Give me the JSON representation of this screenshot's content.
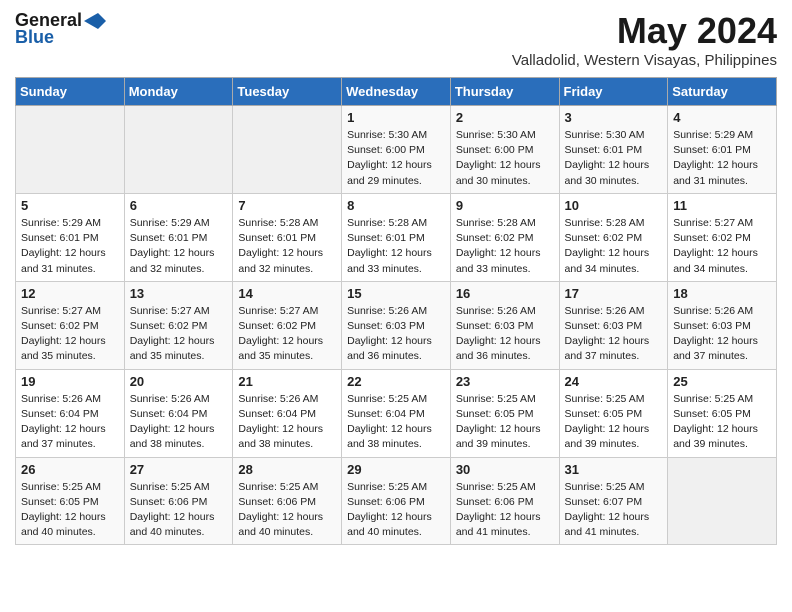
{
  "header": {
    "logo_general": "General",
    "logo_blue": "Blue",
    "title": "May 2024",
    "location": "Valladolid, Western Visayas, Philippines"
  },
  "weekdays": [
    "Sunday",
    "Monday",
    "Tuesday",
    "Wednesday",
    "Thursday",
    "Friday",
    "Saturday"
  ],
  "weeks": [
    [
      {
        "day": "",
        "info": ""
      },
      {
        "day": "",
        "info": ""
      },
      {
        "day": "",
        "info": ""
      },
      {
        "day": "1",
        "info": "Sunrise: 5:30 AM\nSunset: 6:00 PM\nDaylight: 12 hours\nand 29 minutes."
      },
      {
        "day": "2",
        "info": "Sunrise: 5:30 AM\nSunset: 6:00 PM\nDaylight: 12 hours\nand 30 minutes."
      },
      {
        "day": "3",
        "info": "Sunrise: 5:30 AM\nSunset: 6:01 PM\nDaylight: 12 hours\nand 30 minutes."
      },
      {
        "day": "4",
        "info": "Sunrise: 5:29 AM\nSunset: 6:01 PM\nDaylight: 12 hours\nand 31 minutes."
      }
    ],
    [
      {
        "day": "5",
        "info": "Sunrise: 5:29 AM\nSunset: 6:01 PM\nDaylight: 12 hours\nand 31 minutes."
      },
      {
        "day": "6",
        "info": "Sunrise: 5:29 AM\nSunset: 6:01 PM\nDaylight: 12 hours\nand 32 minutes."
      },
      {
        "day": "7",
        "info": "Sunrise: 5:28 AM\nSunset: 6:01 PM\nDaylight: 12 hours\nand 32 minutes."
      },
      {
        "day": "8",
        "info": "Sunrise: 5:28 AM\nSunset: 6:01 PM\nDaylight: 12 hours\nand 33 minutes."
      },
      {
        "day": "9",
        "info": "Sunrise: 5:28 AM\nSunset: 6:02 PM\nDaylight: 12 hours\nand 33 minutes."
      },
      {
        "day": "10",
        "info": "Sunrise: 5:28 AM\nSunset: 6:02 PM\nDaylight: 12 hours\nand 34 minutes."
      },
      {
        "day": "11",
        "info": "Sunrise: 5:27 AM\nSunset: 6:02 PM\nDaylight: 12 hours\nand 34 minutes."
      }
    ],
    [
      {
        "day": "12",
        "info": "Sunrise: 5:27 AM\nSunset: 6:02 PM\nDaylight: 12 hours\nand 35 minutes."
      },
      {
        "day": "13",
        "info": "Sunrise: 5:27 AM\nSunset: 6:02 PM\nDaylight: 12 hours\nand 35 minutes."
      },
      {
        "day": "14",
        "info": "Sunrise: 5:27 AM\nSunset: 6:02 PM\nDaylight: 12 hours\nand 35 minutes."
      },
      {
        "day": "15",
        "info": "Sunrise: 5:26 AM\nSunset: 6:03 PM\nDaylight: 12 hours\nand 36 minutes."
      },
      {
        "day": "16",
        "info": "Sunrise: 5:26 AM\nSunset: 6:03 PM\nDaylight: 12 hours\nand 36 minutes."
      },
      {
        "day": "17",
        "info": "Sunrise: 5:26 AM\nSunset: 6:03 PM\nDaylight: 12 hours\nand 37 minutes."
      },
      {
        "day": "18",
        "info": "Sunrise: 5:26 AM\nSunset: 6:03 PM\nDaylight: 12 hours\nand 37 minutes."
      }
    ],
    [
      {
        "day": "19",
        "info": "Sunrise: 5:26 AM\nSunset: 6:04 PM\nDaylight: 12 hours\nand 37 minutes."
      },
      {
        "day": "20",
        "info": "Sunrise: 5:26 AM\nSunset: 6:04 PM\nDaylight: 12 hours\nand 38 minutes."
      },
      {
        "day": "21",
        "info": "Sunrise: 5:26 AM\nSunset: 6:04 PM\nDaylight: 12 hours\nand 38 minutes."
      },
      {
        "day": "22",
        "info": "Sunrise: 5:25 AM\nSunset: 6:04 PM\nDaylight: 12 hours\nand 38 minutes."
      },
      {
        "day": "23",
        "info": "Sunrise: 5:25 AM\nSunset: 6:05 PM\nDaylight: 12 hours\nand 39 minutes."
      },
      {
        "day": "24",
        "info": "Sunrise: 5:25 AM\nSunset: 6:05 PM\nDaylight: 12 hours\nand 39 minutes."
      },
      {
        "day": "25",
        "info": "Sunrise: 5:25 AM\nSunset: 6:05 PM\nDaylight: 12 hours\nand 39 minutes."
      }
    ],
    [
      {
        "day": "26",
        "info": "Sunrise: 5:25 AM\nSunset: 6:05 PM\nDaylight: 12 hours\nand 40 minutes."
      },
      {
        "day": "27",
        "info": "Sunrise: 5:25 AM\nSunset: 6:06 PM\nDaylight: 12 hours\nand 40 minutes."
      },
      {
        "day": "28",
        "info": "Sunrise: 5:25 AM\nSunset: 6:06 PM\nDaylight: 12 hours\nand 40 minutes."
      },
      {
        "day": "29",
        "info": "Sunrise: 5:25 AM\nSunset: 6:06 PM\nDaylight: 12 hours\nand 40 minutes."
      },
      {
        "day": "30",
        "info": "Sunrise: 5:25 AM\nSunset: 6:06 PM\nDaylight: 12 hours\nand 41 minutes."
      },
      {
        "day": "31",
        "info": "Sunrise: 5:25 AM\nSunset: 6:07 PM\nDaylight: 12 hours\nand 41 minutes."
      },
      {
        "day": "",
        "info": ""
      }
    ]
  ]
}
